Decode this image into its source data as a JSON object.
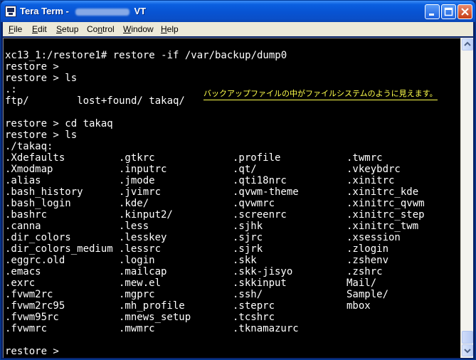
{
  "window": {
    "title_prefix": "Tera Term - ",
    "title_suffix": "VT"
  },
  "menu": [
    {
      "accel": "F",
      "rest": "ile"
    },
    {
      "accel": "E",
      "rest": "dit"
    },
    {
      "accel": "S",
      "rest": "etup"
    },
    {
      "accel": "C",
      "rest": "o",
      "accel2": "n",
      "rest2": "trol"
    },
    {
      "accel": "W",
      "rest": "indow"
    },
    {
      "accel": "H",
      "rest": "elp"
    }
  ],
  "terminal": {
    "lines": [
      "xc13_1:/restore1# restore -if /var/backup/dump0",
      "restore >",
      "restore > ls",
      ".:",
      "ftp/        lost+found/ takaq/",
      "",
      "restore > cd takaq",
      "restore > ls",
      "./takaq:"
    ],
    "listing": [
      [
        ".Xdefaults",
        ".gtkrc",
        ".profile",
        ".twmrc"
      ],
      [
        ".Xmodmap",
        ".inputrc",
        ".qt/",
        ".vkeybdrc"
      ],
      [
        ".alias",
        ".jmode",
        ".qti18nrc",
        ".xinitrc"
      ],
      [
        ".bash_history",
        ".jvimrc",
        ".qvwm-theme",
        ".xinitrc_kde"
      ],
      [
        ".bash_login",
        ".kde/",
        ".qvwmrc",
        ".xinitrc_qvwm"
      ],
      [
        ".bashrc",
        ".kinput2/",
        ".screenrc",
        ".xinitrc_step"
      ],
      [
        ".canna",
        ".less",
        ".sjhk",
        ".xinitrc_twm"
      ],
      [
        ".dir_colors",
        ".lesskey",
        ".sjrc",
        ".xsession"
      ],
      [
        ".dir_colors_medium",
        ".lessrc",
        ".sjrk",
        ".zlogin"
      ],
      [
        ".eggrc.old",
        ".login",
        ".skk",
        ".zshenv"
      ],
      [
        ".emacs",
        ".mailcap",
        ".skk-jisyo",
        ".zshrc"
      ],
      [
        ".exrc",
        ".mew.el",
        ".skkinput",
        "Mail/"
      ],
      [
        ".fvwm2rc",
        ".mgprc",
        ".ssh/",
        "Sample/"
      ],
      [
        ".fvwm2rc95",
        ".mh_profile",
        ".steprc",
        "mbox"
      ],
      [
        ".fvwm95rc",
        ".mnews_setup",
        ".tcshrc",
        ""
      ],
      [
        ".fvwmrc",
        ".mwmrc",
        ".tknamazurc",
        ""
      ]
    ],
    "prompt_final": "restore >",
    "annotation": "バックアップファイルの中がファイルシステムのように見えます。"
  },
  "colors": {
    "terminal_bg": "#000000",
    "terminal_fg": "#ffffff",
    "annotation": "#ffff4a",
    "titlebar": "#0a5fe0"
  },
  "icons": [
    "teraterm-app-icon",
    "minimize-icon",
    "maximize-icon",
    "close-icon",
    "scroll-up-arrow-icon",
    "scroll-down-arrow-icon"
  ]
}
